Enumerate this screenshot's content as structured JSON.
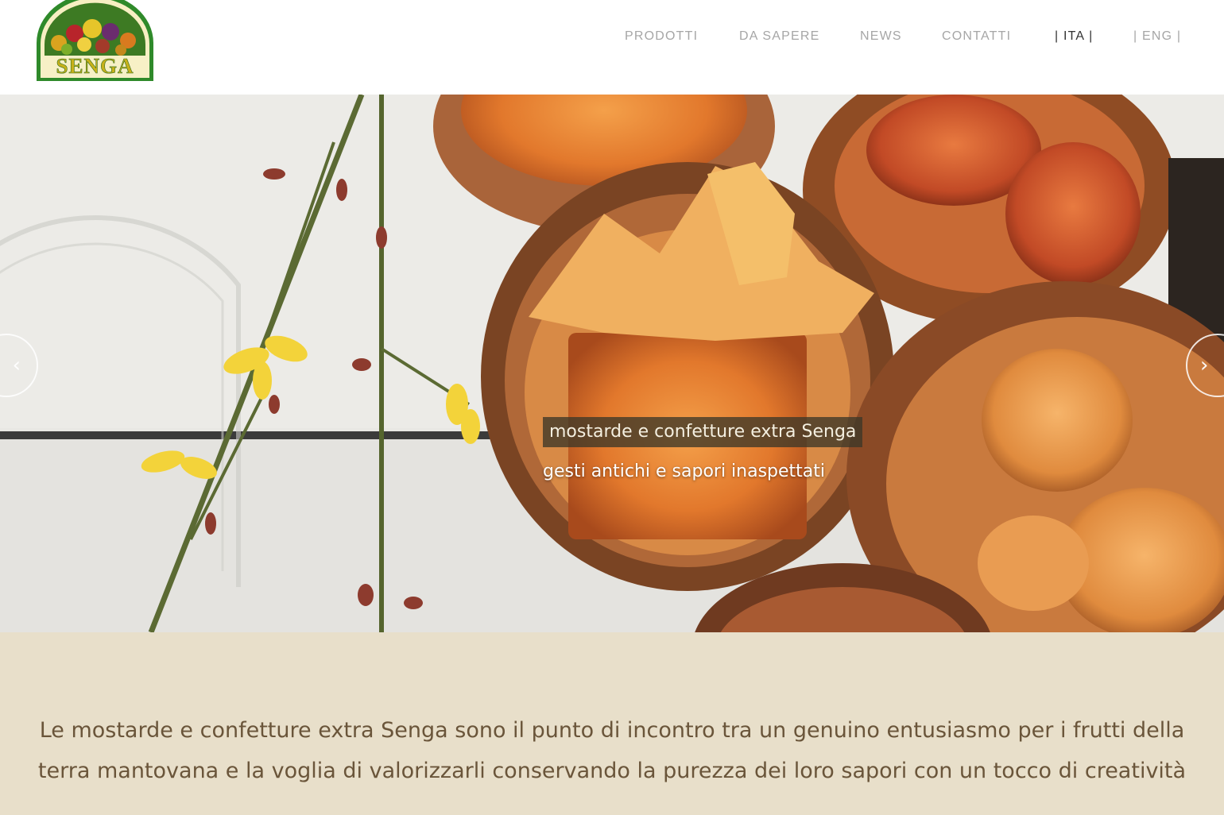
{
  "header": {
    "logo_text": "SENGA",
    "nav": [
      {
        "label": "PRODOTTI",
        "active": false
      },
      {
        "label": "DA SAPERE",
        "active": false
      },
      {
        "label": "NEWS",
        "active": false
      },
      {
        "label": "CONTATTI",
        "active": false
      },
      {
        "label": "| ITA |",
        "active": true
      },
      {
        "label": "| ENG |",
        "active": false
      }
    ]
  },
  "hero": {
    "caption_title": "mostarde e confetture extra Senga",
    "caption_subtitle": "gesti antichi e sapori inaspettati",
    "prev_icon": "‹",
    "next_icon": "›"
  },
  "intro": {
    "text": "Le mostarde e confetture extra Senga sono il punto di incontro tra un genuino entusiasmo per i frutti della terra mantovana e la voglia di valorizzarli conservando la purezza dei loro sapori con un tocco di creatività"
  },
  "colors": {
    "nav_text": "#a6a6a6",
    "nav_active": "#333333",
    "logo_green": "#2f6d1c",
    "logo_gold": "#c8b11a",
    "intro_bg": "#e8dfca",
    "intro_text": "#6a553a",
    "caption_bg": "#3c3728"
  }
}
